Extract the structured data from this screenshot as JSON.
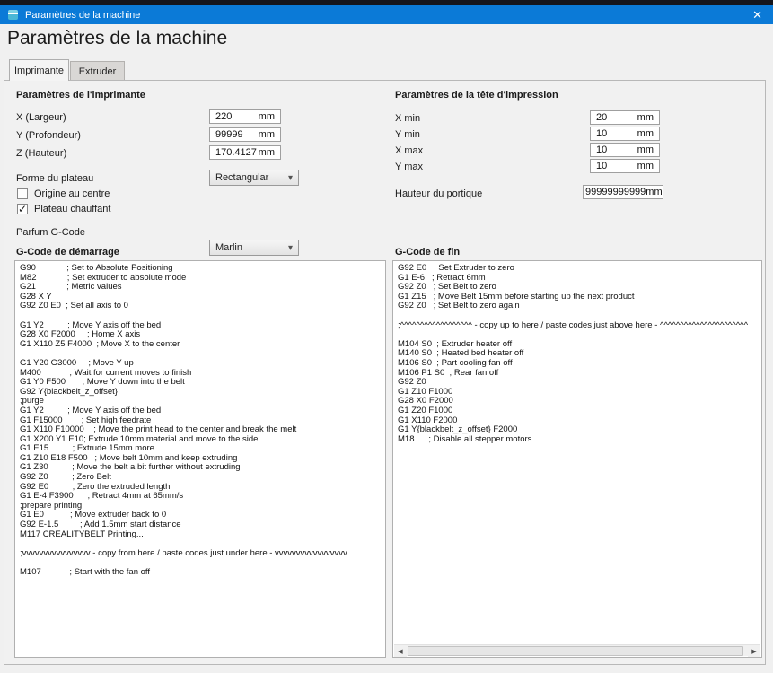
{
  "window": {
    "title": "Paramètres de la machine"
  },
  "icons": {
    "close": "✕",
    "checkmark": "✓",
    "dropdown_arrow": "▾",
    "scroll_left": "◀",
    "scroll_right": "▶"
  },
  "colors": {
    "titlebar_blue": "#0b7ad7",
    "top_strip": "#15161d",
    "dialog_bg": "#f0f0f0",
    "field_border": "#9f9f9f",
    "tab_inactive_bg": "#d9d7d5"
  },
  "header": {
    "title": "Paramètres de la machine"
  },
  "tabs": [
    {
      "label": "Imprimante"
    },
    {
      "label": "Extruder"
    }
  ],
  "printer": {
    "title": "Paramètres de l'imprimante",
    "rows": [
      {
        "label": "X (Largeur)",
        "value": "220",
        "unit": "mm"
      },
      {
        "label": "Y (Profondeur)",
        "value": "99999",
        "unit": "mm"
      },
      {
        "label": "Z (Hauteur)",
        "value": "170.4127",
        "unit": "mm"
      }
    ],
    "shape": {
      "label": "Forme du plateau",
      "value": "Rectangular"
    },
    "origin_center": {
      "label": "Origine au centre",
      "checked": false
    },
    "heated_bed": {
      "label": "Plateau chauffant",
      "checked": true
    },
    "flavor": {
      "label": "Parfum G-Code",
      "value": "Marlin"
    }
  },
  "printhead": {
    "title": "Paramètres de la tête d'impression",
    "rows": [
      {
        "label": "X min",
        "value": "20",
        "unit": "mm"
      },
      {
        "label": "Y min",
        "value": "10",
        "unit": "mm"
      },
      {
        "label": "X max",
        "value": "10",
        "unit": "mm"
      },
      {
        "label": "Y max",
        "value": "10",
        "unit": "mm"
      }
    ],
    "gantry": {
      "label": "Hauteur du portique",
      "value": "99999999999",
      "unit": "mm"
    }
  },
  "start_gcode": {
    "title": "G-Code de démarrage",
    "text": "G90             ; Set to Absolute Positioning\nM82             ; Set extruder to absolute mode\nG21             ; Metric values\nG28 X Y\nG92 Z0 E0  ; Set all axis to 0\n\nG1 Y2          ; Move Y axis off the bed\nG28 X0 F2000     ; Home X axis\nG1 X110 Z5 F4000  ; Move X to the center\n\nG1 Y20 G3000     ; Move Y up\nM400            ; Wait for current moves to finish\nG1 Y0 F500       ; Move Y down into the belt\nG92 Y{blackbelt_z_offset}\n;purge\nG1 Y2          ; Move Y axis off the bed\nG1 F15000        ; Set high feedrate\nG1 X110 F10000    ; Move the print head to the center and break the melt\nG1 X200 Y1 E10; Extrude 10mm material and move to the side\nG1 E15          ; Extrude 15mm more\nG1 Z10 E18 F500   ; Move belt 10mm and keep extruding\nG1 Z30          ; Move the belt a bit further without extruding\nG92 Z0          ; Zero Belt\nG92 E0          ; Zero the extruded length\nG1 E-4 F3900      ; Retract 4mm at 65mm/s\n;prepare printing\nG1 E0           ; Move extruder back to 0\nG92 E-1.5         ; Add 1.5mm start distance\nM117 CREALITYBELT Printing...\n\n;vvvvvvvvvvvvvvvv - copy from here / paste codes just under here - vvvvvvvvvvvvvvvvv\n\nM107            ; Start with the fan off"
  },
  "end_gcode": {
    "title": "G-Code de fin",
    "text": "G92 E0   ; Set Extruder to zero\nG1 E-6   ; Retract 6mm\nG92 Z0   ; Set Belt to zero\nG1 Z15   ; Move Belt 15mm before starting up the next product\nG92 Z0   ; Set Belt to zero again\n\n;^^^^^^^^^^^^^^^^^^ - copy up to here / paste codes just above here - ^^^^^^^^^^^^^^^^^^^^^^\n\nM104 S0  ; Extruder heater off\nM140 S0  ; Heated bed heater off\nM106 S0  ; Part cooling fan off\nM106 P1 S0  ; Rear fan off\nG92 Z0\nG1 Z10 F1000\nG28 X0 F2000\nG1 Z20 F1000\nG1 X110 F2000\nG1 Y{blackbelt_z_offset} F2000\nM18      ; Disable all stepper motors"
  }
}
